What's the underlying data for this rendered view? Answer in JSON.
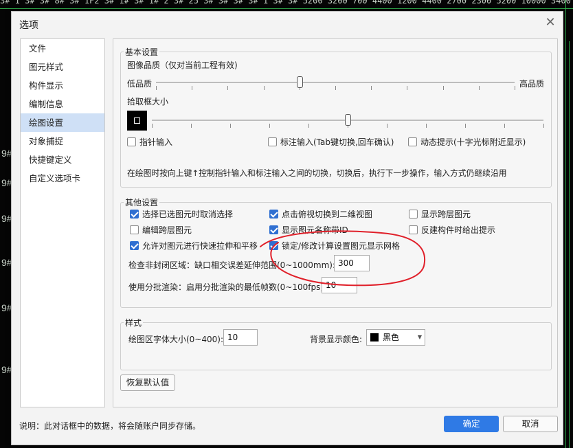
{
  "background": {
    "top_text": "3# 1 3# 3# 8# 3# 1F2 3# 1# 3# 1# 2 3# 25 3# 3# 3# 3# 1 3# 3#  5200 3200 700 4400 1200 4400 2700 2300 5200  10000  3400 4600 3700",
    "left_marks": [
      "9#",
      "9#",
      "9#",
      "9#",
      "9#",
      "9#",
      "9#",
      "9#",
      "9#"
    ],
    "line_color": "#2fa84a"
  },
  "dialog": {
    "title": "选项",
    "close_icon": "close-icon"
  },
  "nav": {
    "items": [
      {
        "label": "文件"
      },
      {
        "label": "图元样式"
      },
      {
        "label": "构件显示"
      },
      {
        "label": "编制信息"
      },
      {
        "label": "绘图设置",
        "active": true
      },
      {
        "label": "对象捕捉"
      },
      {
        "label": "快捷键定义"
      },
      {
        "label": "自定义选项卡"
      }
    ]
  },
  "basic": {
    "legend": "基本设置",
    "image_quality_label": "图像品质（仅对当前工程有效)",
    "low_label": "低品质",
    "high_label": "高品质",
    "image_quality_level": 0.4,
    "pick_box_label": "拾取框大小",
    "pick_box_level": 0.5,
    "pointer_input": {
      "label": "指针输入",
      "checked": false
    },
    "dimension_input": {
      "label": "标注输入(Tab键切换,回车确认)",
      "checked": false
    },
    "dynamic_tip": {
      "label": "动态提示(十字光标附近显示)",
      "checked": false
    },
    "hint": "在绘图时按向上键↑控制指针输入和标注输入之间的切换，切换后，执行下一步操作，输入方式仍继续沿用"
  },
  "other": {
    "legend": "其他设置",
    "checkboxes": [
      {
        "label": "选择已选图元时取消选择",
        "checked": true
      },
      {
        "label": "点击俯视切换到二维视图",
        "checked": true
      },
      {
        "label": "显示跨层图元",
        "checked": false
      },
      {
        "label": "编辑跨层图元",
        "checked": false
      },
      {
        "label": "显示图元名称带ID",
        "checked": true
      },
      {
        "label": "反建构件时给出提示",
        "checked": false
      },
      {
        "label": "允许对图元进行快速拉伸和平移",
        "checked": true
      },
      {
        "label": "锁定/修改计算设置图元显示网格",
        "checked": true
      }
    ],
    "gap_label": "检查非封闭区域：缺口相交误差延伸范围(0~1000mm):",
    "gap_value": "300",
    "batch_label": "使用分批渲染：启用分批渲染的最低帧数(0~100fps):",
    "batch_value": "10"
  },
  "style": {
    "legend": "样式",
    "font_size_label": "绘图区字体大小(0~400):",
    "font_size_value": "10",
    "bg_color_label": "背景显示颜色:",
    "bg_color_value": "黑色",
    "bg_color_hex": "#000000"
  },
  "restore_button": "恢复默认值",
  "footer": {
    "note": "说明：此对话框中的数据，将会随账户同步存储。",
    "ok": "确定",
    "cancel": "取消"
  },
  "annotation": {
    "color": "#e0202a"
  }
}
